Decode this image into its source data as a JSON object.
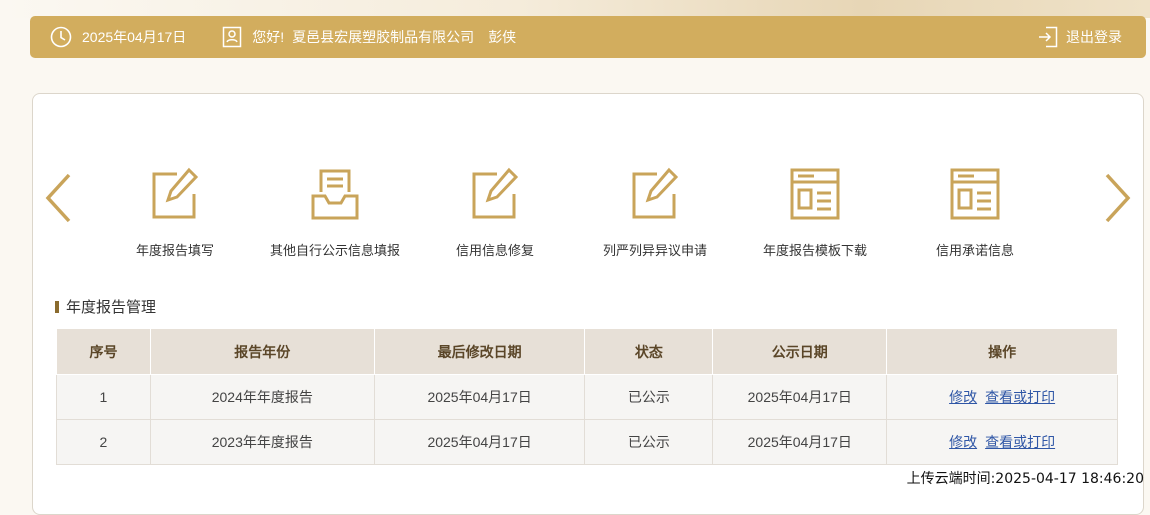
{
  "header": {
    "date": "2025年04月17日",
    "greeting": "您好!",
    "company": "夏邑县宏展塑胶制品有限公司",
    "user_name": "彭侠",
    "logout_label": "退出登录"
  },
  "menu": {
    "items": [
      {
        "label": "年度报告填写",
        "icon": "edit-icon"
      },
      {
        "label": "其他自行公示信息填报",
        "icon": "inbox-document-icon"
      },
      {
        "label": "信用信息修复",
        "icon": "edit-icon"
      },
      {
        "label": "列严列异异议申请",
        "icon": "edit-icon"
      },
      {
        "label": "年度报告模板下载",
        "icon": "template-icon"
      },
      {
        "label": "信用承诺信息",
        "icon": "template-icon"
      }
    ]
  },
  "section": {
    "title": "年度报告管理"
  },
  "table": {
    "headers": [
      "序号",
      "报告年份",
      "最后修改日期",
      "状态",
      "公示日期",
      "操作"
    ],
    "rows": [
      {
        "no": "1",
        "year": "2024年年度报告",
        "modified": "2025年04月17日",
        "status": "已公示",
        "published": "2025年04月17日",
        "edit": "修改",
        "view": "查看或打印"
      },
      {
        "no": "2",
        "year": "2023年年度报告",
        "modified": "2025年04月17日",
        "status": "已公示",
        "published": "2025年04月17日",
        "edit": "修改",
        "view": "查看或打印"
      }
    ]
  },
  "footer": {
    "upload_time": "上传云端时间:2025-04-17 18:46:20"
  },
  "colors": {
    "accent": "#d2ad5e",
    "icon": "#c9a45a",
    "link": "#2f56a6"
  }
}
